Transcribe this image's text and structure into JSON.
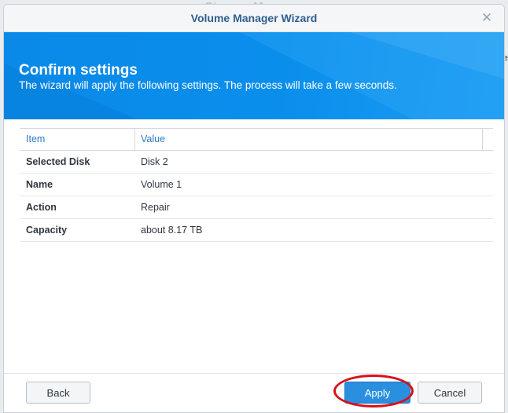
{
  "background": {
    "title": "Storage Manager"
  },
  "window": {
    "title": "Volume Manager Wizard",
    "close_glyph": "✕"
  },
  "banner": {
    "heading": "Confirm settings",
    "description": "The wizard will apply the following settings. The process will take a few seconds."
  },
  "grid": {
    "columns": [
      "Item",
      "Value"
    ],
    "rows": [
      {
        "item": "Selected Disk",
        "value": "Disk 2"
      },
      {
        "item": "Name",
        "value": "Volume 1"
      },
      {
        "item": "Action",
        "value": "Repair"
      },
      {
        "item": "Capacity",
        "value": "about 8.17 TB"
      }
    ]
  },
  "footer": {
    "back_label": "Back",
    "apply_label": "Apply",
    "cancel_label": "Cancel"
  },
  "annotation": {
    "color": "#d8101b",
    "highlighted": "Apply"
  },
  "colors": {
    "accent": "#0a8eec",
    "primary_button": "#2b8fe0",
    "header_text": "#2c7bc6"
  }
}
